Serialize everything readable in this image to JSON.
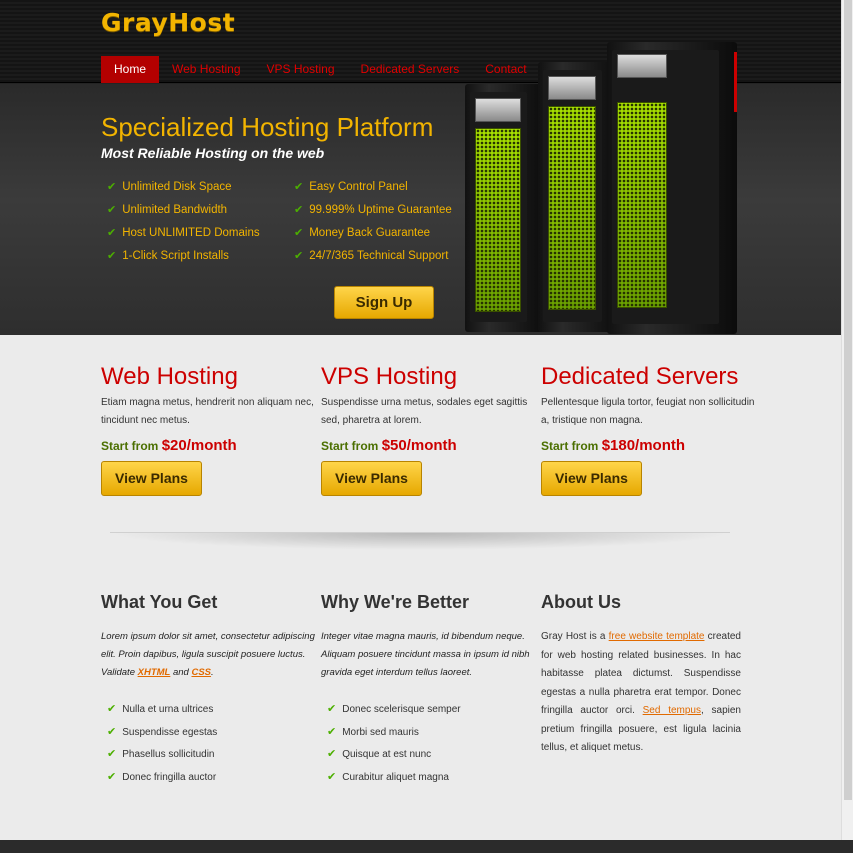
{
  "brand": {
    "logo": "GrayHost"
  },
  "nav": [
    "Home",
    "Web Hosting",
    "VPS Hosting",
    "Dedicated Servers",
    "Contact"
  ],
  "hero": {
    "title": "Specialized Hosting Platform",
    "subtitle": "Most Reliable Hosting on the web",
    "features": [
      "Unlimited Disk Space",
      "Easy Control Panel",
      "Unlimited Bandwidth",
      "99.999% Uptime Guarantee",
      "Host UNLIMITED Domains",
      "Money Back Guarantee",
      "1-Click Script Installs",
      "24/7/365 Technical Support"
    ],
    "signup_label": "Sign Up"
  },
  "plans": [
    {
      "title": "Web Hosting",
      "desc": "Etiam magna metus, hendrerit non aliquam nec, tincidunt nec metus.",
      "price_prefix": "Start from",
      "price": "$20/month",
      "button": "View Plans"
    },
    {
      "title": "VPS Hosting",
      "desc": "Suspendisse urna metus, sodales eget sagittis sed, pharetra at lorem.",
      "price_prefix": "Start from",
      "price": "$50/month",
      "button": "View Plans"
    },
    {
      "title": "Dedicated Servers",
      "desc": "Pellentesque ligula tortor, feugiat non sollicitudin a, tristique non magna.",
      "price_prefix": "Start from",
      "price": "$180/month",
      "button": "View Plans"
    }
  ],
  "what": {
    "title": "What You Get",
    "intro_a": "Lorem ipsum dolor sit amet, consectetur adipiscing elit. Proin dapibus, ligula suscipit posuere luctus. Validate ",
    "link1": "XHTML",
    "intro_and": " and ",
    "link2": "CSS",
    "intro_end": ".",
    "items": [
      "Nulla et urna ultrices",
      "Suspendisse egestas",
      "Phasellus sollicitudin",
      "Donec fringilla auctor"
    ]
  },
  "why": {
    "title": "Why We're Better",
    "intro": "Integer vitae magna mauris, id bibendum neque. Aliquam posuere tincidunt massa in ipsum id nibh gravida eget interdum tellus laoreet.",
    "items": [
      "Donec scelerisque semper",
      "Morbi sed mauris",
      "Quisque at est nunc",
      "Curabitur aliquet magna"
    ]
  },
  "about": {
    "title": "About Us",
    "text_a": "Gray Host is a ",
    "link1": "free website template",
    "text_b": " created for web hosting related businesses. In hac habitasse platea dictumst. Suspendisse egestas a nulla pharetra erat tempor. Donec fringilla auctor orci. ",
    "link2": "Sed tempus",
    "text_c": ", sapien pretium fringilla posuere, est ligula lacinia tellus, et aliquet metus."
  },
  "colors": {
    "accent": "#f2b400",
    "red": "#cc0000",
    "green": "#4caf00",
    "link": "#e16a00"
  }
}
